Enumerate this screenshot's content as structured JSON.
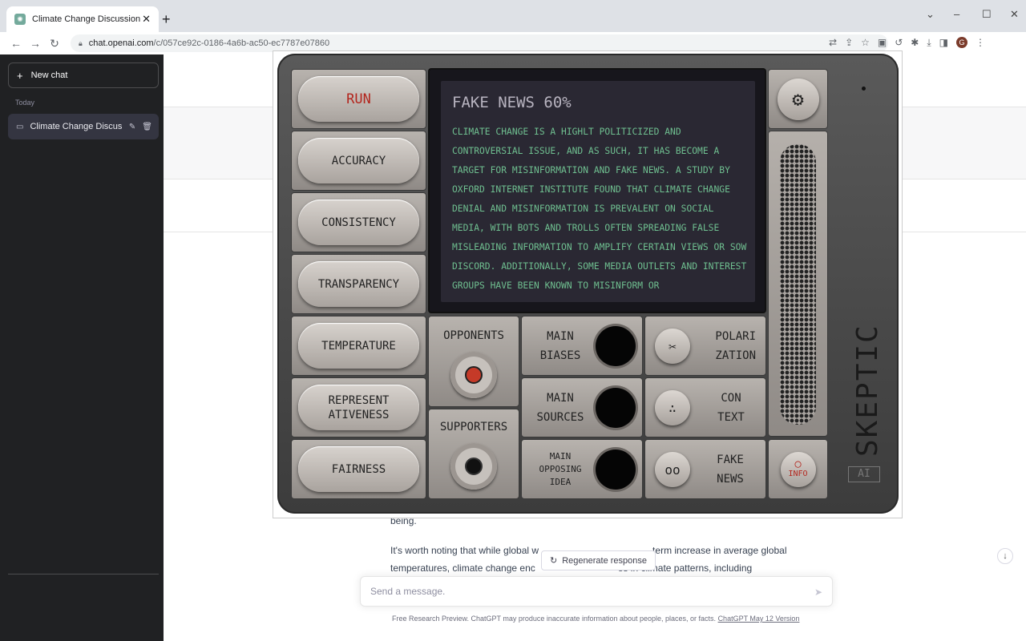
{
  "browser": {
    "tab_title": "Climate Change Discussion",
    "url_host": "chat.openai.com",
    "url_path": "/c/057ce92c-0186-4a6b-ac50-ec7787e07860"
  },
  "sidebar": {
    "new_chat": "New chat",
    "section": "Today",
    "chat_item": "Climate Change Discus"
  },
  "chat": {
    "partial_line": "being.",
    "para_line1_a": "It's worth noting that while global w",
    "para_line1_b": "-term increase in average global",
    "para_line2_a": "temperatures, climate change enc",
    "para_line2_b": "es in climate patterns, including",
    "regenerate": "Regenerate response",
    "input_placeholder": "Send a message.",
    "footer": "Free Research Preview. ChatGPT may produce inaccurate information about people, places, or facts.",
    "footer_link": "ChatGPT May 12 Version"
  },
  "device": {
    "left_buttons": [
      "RUN",
      "ACCURACY",
      "CONSISTENCY",
      "TRANSPARENCY",
      "TEMPERATURE",
      "REPRESENT ATIVENESS",
      "FAIRNESS"
    ],
    "screen_title": "FAKE NEWS 60%",
    "screen_text": "CLIMATE CHANGE IS A HIGHLT POLITICIZED AND CONTROVERSIAL ISSUE, AND AS SUCH, IT HAS BECOME A TARGET FOR MISINFORMATION AND FAKE NEWS. A STUDY BY OXFORD INTERNET INSTITUTE FOUND THAT CLIMATE CHANGE DENIAL AND MISINFORMATION IS PREVALENT ON SOCIAL MEDIA, WITH BOTS AND TROLLS OFTEN SPREADING FALSE MISLEADING INFORMATION TO AMPLIFY CERTAIN VIEWS OR SOW DISCORD. ADDITIONALLY, SOME MEDIA OUTLETS AND INTEREST GROUPS HAVE BEEN KNOWN TO MISINFORM OR",
    "opponents": "OPPONENTS",
    "supporters": "SUPPORTERS",
    "main_biases": "MAIN BIASES",
    "main_sources": "MAIN SOURCES",
    "main_opposing_idea": "MAIN OPPOSING IDEA",
    "polarization": "POLARI ZATION",
    "context": "CON TEXT",
    "fake_news": "FAKE NEWS",
    "info": "INFO",
    "brand": "SKEPTIC",
    "ai_tag": "AI",
    "colors": {
      "run": "#b3261e",
      "screen_text": "#6fbf90",
      "info": "#b3261e"
    }
  }
}
